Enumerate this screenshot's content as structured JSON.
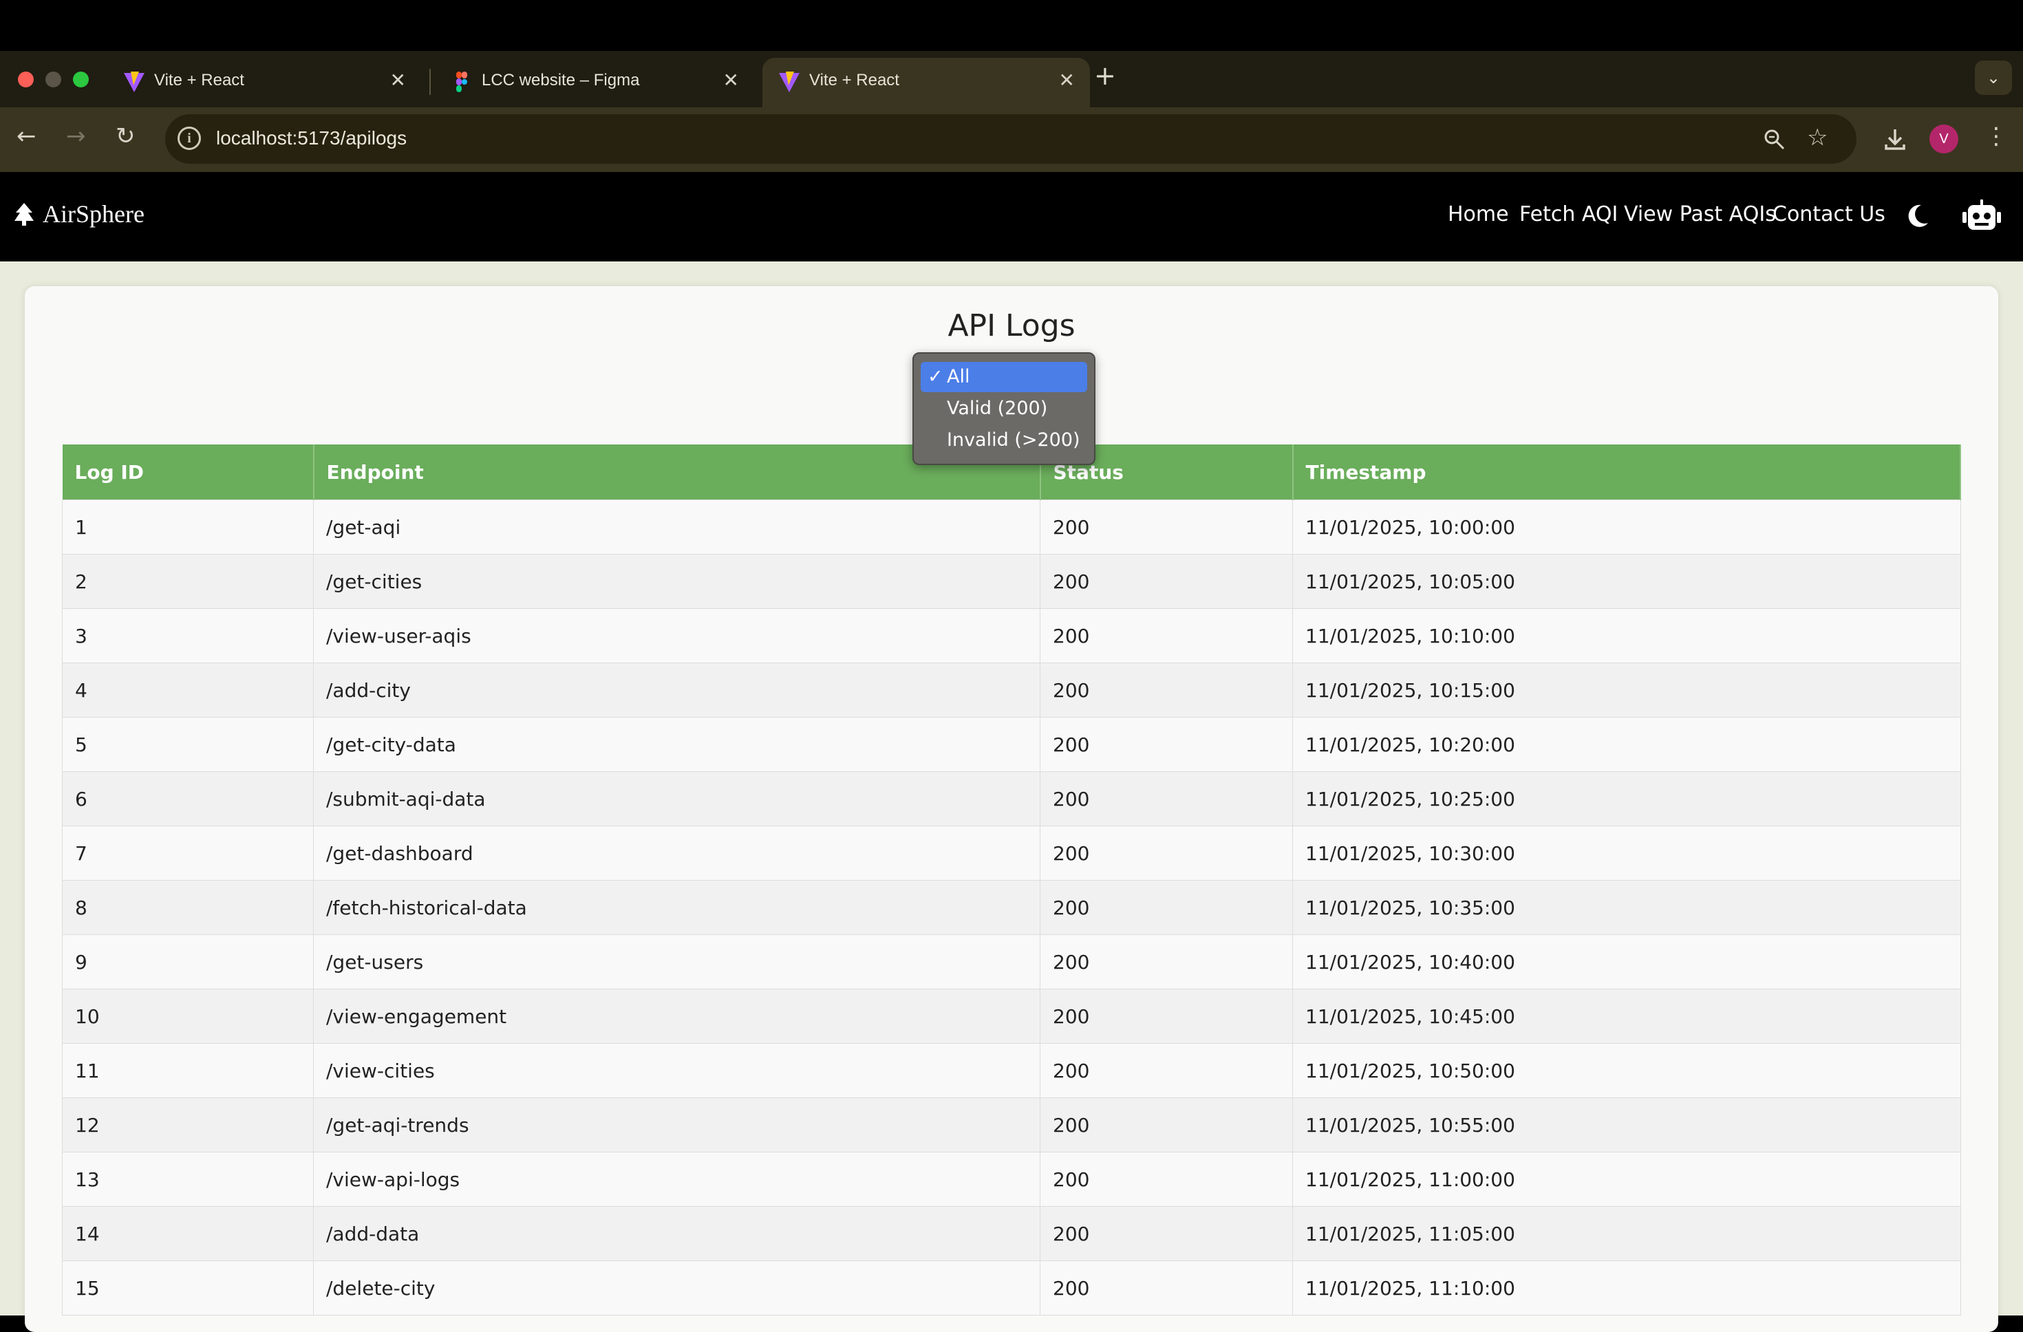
{
  "browser": {
    "tabs": [
      {
        "title": "Vite + React",
        "favicon": "vite-icon",
        "active": false
      },
      {
        "title": "LCC website – Figma",
        "favicon": "figma-icon",
        "active": false
      },
      {
        "title": "Vite + React",
        "favicon": "vite-icon",
        "active": true
      }
    ],
    "url": "localhost:5173/apilogs",
    "profile_initial": "V",
    "colors": {
      "tab_bar": "#201d12",
      "toolbar": "#3a3520",
      "profile": "#b4266a"
    }
  },
  "app": {
    "brand": "AirSphere",
    "brand_icon": "tree-icon",
    "nav": [
      "Home",
      "Fetch AQI",
      "View Past AQIs",
      "Contact Us"
    ],
    "theme_icon": "moon-icon",
    "bot_icon": "robot-icon"
  },
  "page": {
    "title": "API Logs",
    "filter": {
      "options": [
        "All",
        "Valid (200)",
        "Invalid (>200)"
      ],
      "selected": "All",
      "check_mark": "✓"
    },
    "table": {
      "columns": [
        "Log ID",
        "Endpoint",
        "Status",
        "Timestamp"
      ],
      "rows": [
        [
          "1",
          "/get-aqi",
          "200",
          "11/01/2025, 10:00:00"
        ],
        [
          "2",
          "/get-cities",
          "200",
          "11/01/2025, 10:05:00"
        ],
        [
          "3",
          "/view-user-aqis",
          "200",
          "11/01/2025, 10:10:00"
        ],
        [
          "4",
          "/add-city",
          "200",
          "11/01/2025, 10:15:00"
        ],
        [
          "5",
          "/get-city-data",
          "200",
          "11/01/2025, 10:20:00"
        ],
        [
          "6",
          "/submit-aqi-data",
          "200",
          "11/01/2025, 10:25:00"
        ],
        [
          "7",
          "/get-dashboard",
          "200",
          "11/01/2025, 10:30:00"
        ],
        [
          "8",
          "/fetch-historical-data",
          "200",
          "11/01/2025, 10:35:00"
        ],
        [
          "9",
          "/get-users",
          "200",
          "11/01/2025, 10:40:00"
        ],
        [
          "10",
          "/view-engagement",
          "200",
          "11/01/2025, 10:45:00"
        ],
        [
          "11",
          "/view-cities",
          "200",
          "11/01/2025, 10:50:00"
        ],
        [
          "12",
          "/get-aqi-trends",
          "200",
          "11/01/2025, 10:55:00"
        ],
        [
          "13",
          "/view-api-logs",
          "200",
          "11/01/2025, 11:00:00"
        ],
        [
          "14",
          "/add-data",
          "200",
          "11/01/2025, 11:05:00"
        ],
        [
          "15",
          "/delete-city",
          "200",
          "11/01/2025, 11:10:00"
        ]
      ]
    },
    "colors": {
      "header_green": "#6aad5b",
      "background": "#e9ebdc",
      "select_blue": "#4c7ee8"
    }
  }
}
